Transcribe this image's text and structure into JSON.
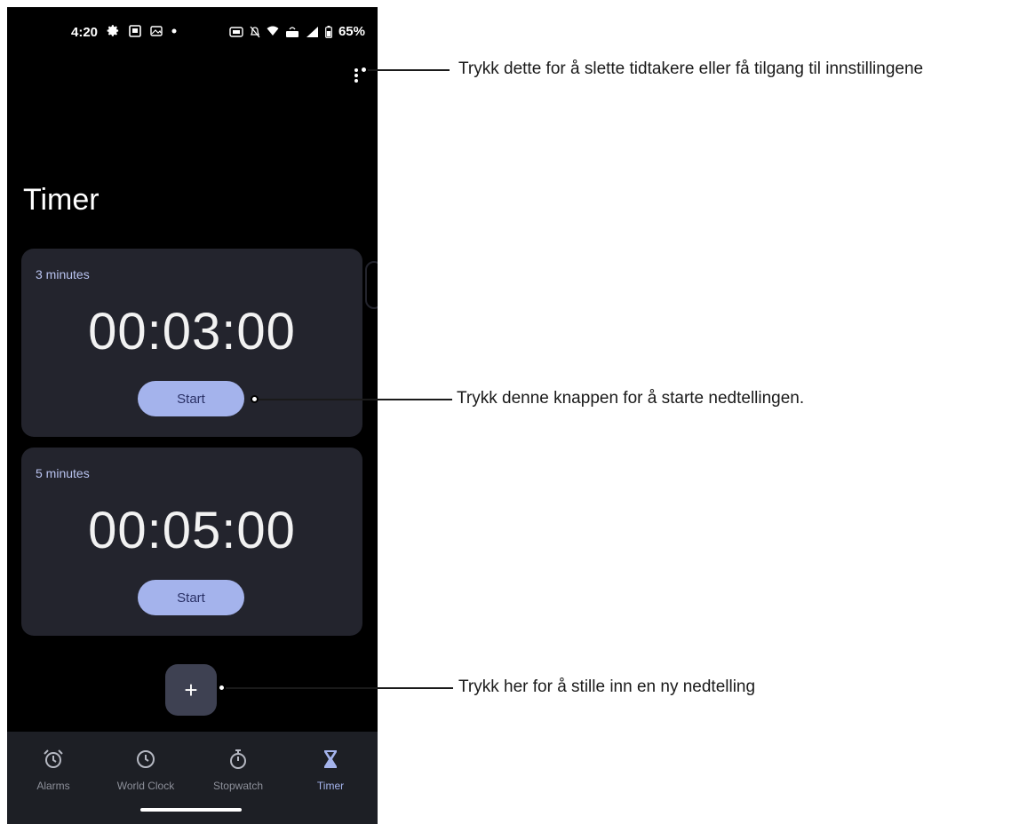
{
  "status_bar": {
    "time": "4:20",
    "battery": "65%"
  },
  "page": {
    "title": "Timer"
  },
  "timers": [
    {
      "label": "3 minutes",
      "time": "00:03:00",
      "start_label": "Start"
    },
    {
      "label": "5 minutes",
      "time": "00:05:00",
      "start_label": "Start"
    }
  ],
  "fab": {
    "label": "+"
  },
  "nav": {
    "items": [
      {
        "label": "Alarms",
        "icon": "alarm-icon"
      },
      {
        "label": "World Clock",
        "icon": "clock-icon"
      },
      {
        "label": "Stopwatch",
        "icon": "stopwatch-icon"
      },
      {
        "label": "Timer",
        "icon": "hourglass-icon",
        "active": true
      }
    ]
  },
  "callouts": {
    "menu": "Trykk dette for å slette tidtakere eller få tilgang til innstillingene",
    "start": "Trykk denne knappen for å starte nedtellingen.",
    "add": "Trykk her for å stille inn en ny nedtelling"
  },
  "colors": {
    "background": "#000000",
    "card": "#23242d",
    "accent": "#a4b3ec",
    "nav_background": "#1d1f25"
  }
}
